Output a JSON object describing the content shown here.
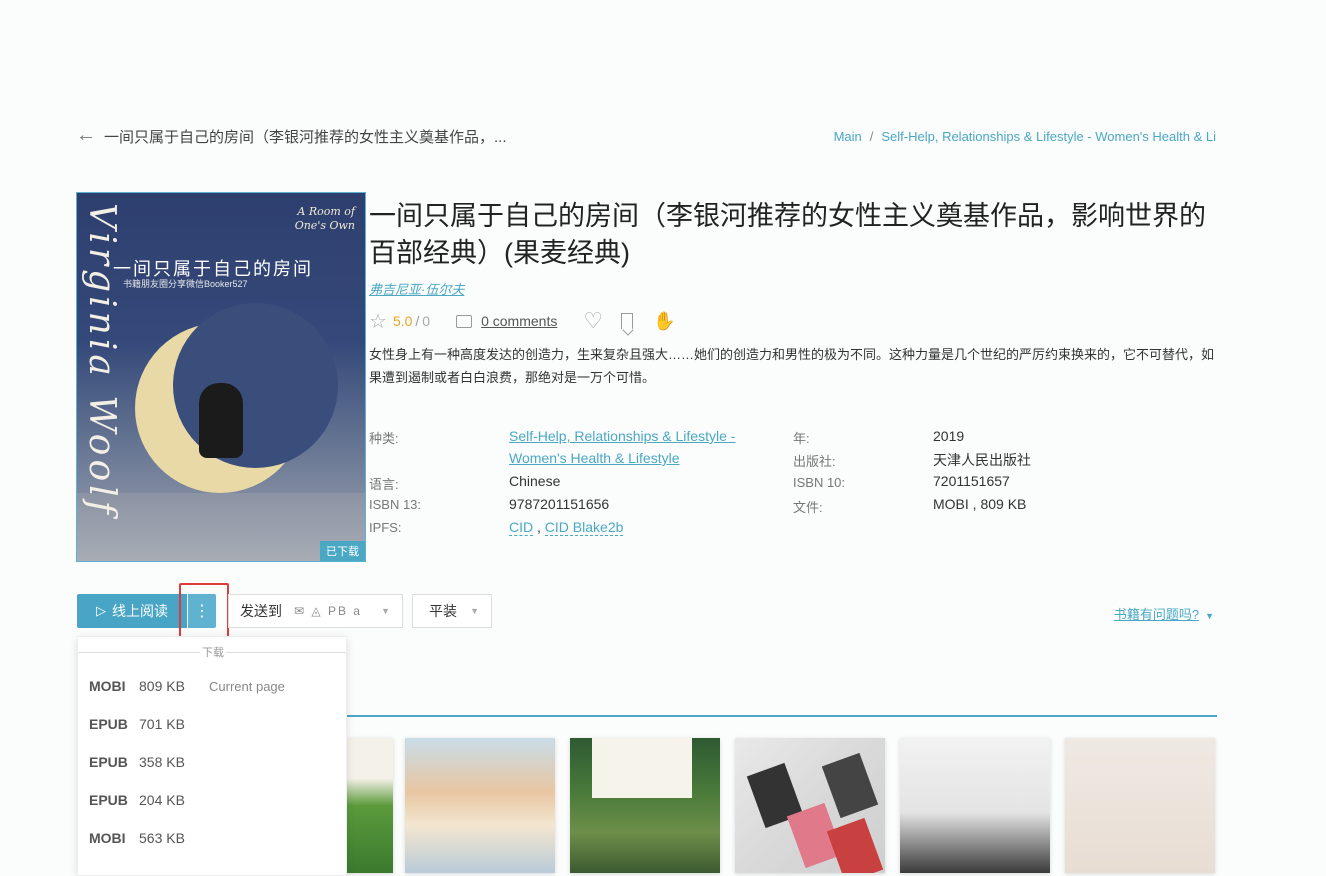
{
  "header": {
    "title": "一间只属于自己的房间（李银河推荐的女性主义奠基作品，...",
    "breadcrumb": [
      "Main",
      "Self-Help, Relationships & Lifestyle - Women's Health & Li"
    ],
    "breadcrumb_sep": "/"
  },
  "cover": {
    "vertical_text": "Virginia Woolf",
    "en_title": "A Room of One's Own",
    "cn_title": "一间只属于自己的房间",
    "sub_text": "书籍朋友圈分享微信Booker527",
    "badge": "已下载"
  },
  "book": {
    "title": "一间只属于自己的房间（李银河推荐的女性主义奠基作品，影响世界的百部经典）(果麦经典)",
    "author": "弗吉尼亚·伍尔夫",
    "rating": "5.0",
    "rating_sep": "/",
    "rating_max": "0",
    "comments": "0 comments",
    "description": "女性身上有一种高度发达的创造力，生来复杂且强大……她们的创造力和男性的极为不同。这种力量是几个世纪的严厉约束换来的，它不可替代，如果遭到遏制或者白白浪费，那绝对是一万个可惜。"
  },
  "properties": {
    "category_label": "种类:",
    "category_value_1": "Self-Help, Relationships & Lifestyle -",
    "category_value_2": "Women's Health & Lifestyle",
    "year_label": "年:",
    "year_value": "2019",
    "publisher_label": "出版社:",
    "publisher_value": "天津人民出版社",
    "language_label": "语言:",
    "language_value": "Chinese",
    "isbn13_label": "ISBN 13:",
    "isbn13_value": "9787201151656",
    "isbn10_label": "ISBN 10:",
    "isbn10_value": "7201151657",
    "file_label": "文件:",
    "file_value": "MOBI , 809 KB",
    "ipfs_label": "IPFS:",
    "ipfs_cid": "CID",
    "ipfs_sep": " , ",
    "ipfs_blake": "CID Blake2b"
  },
  "buttons": {
    "read_online": "线上阅读",
    "more": "⋮",
    "send_to": "发送到",
    "send_icons": "✉ ◬ PB a",
    "binding": "平装",
    "problem": "书籍有问题吗?"
  },
  "dropdown": {
    "header": "下载",
    "items": [
      {
        "format": "MOBI",
        "size": "809 KB",
        "note": "Current page"
      },
      {
        "format": "EPUB",
        "size": "701 KB",
        "note": ""
      },
      {
        "format": "EPUB",
        "size": "358 KB",
        "note": ""
      },
      {
        "format": "EPUB",
        "size": "204 KB",
        "note": ""
      },
      {
        "format": "MOBI",
        "size": "563 KB",
        "note": ""
      }
    ]
  },
  "colors": {
    "accent": "#4aa8c4",
    "rating": "#e8a628",
    "highlight": "#e03a3a"
  }
}
